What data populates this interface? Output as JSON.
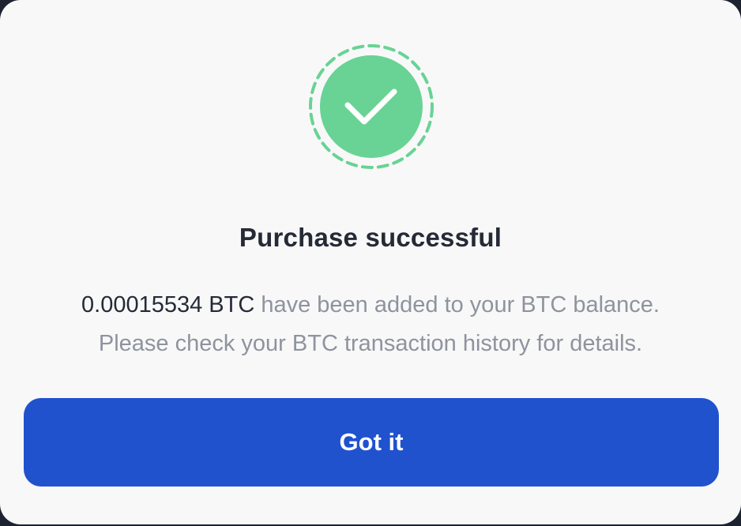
{
  "dialog": {
    "icon": "check-icon",
    "title": "Purchase successful",
    "amount": "0.00015534 BTC",
    "message_line1_rest": " have been added to your BTC balance.",
    "message_line2": "Please check your BTC transaction history for details.",
    "button_label": "Got it"
  },
  "colors": {
    "background": "#f8f8f9",
    "success_green": "#68d394",
    "button_blue": "#2052ce",
    "title_text": "#252a36",
    "muted_text": "#8e939d"
  }
}
